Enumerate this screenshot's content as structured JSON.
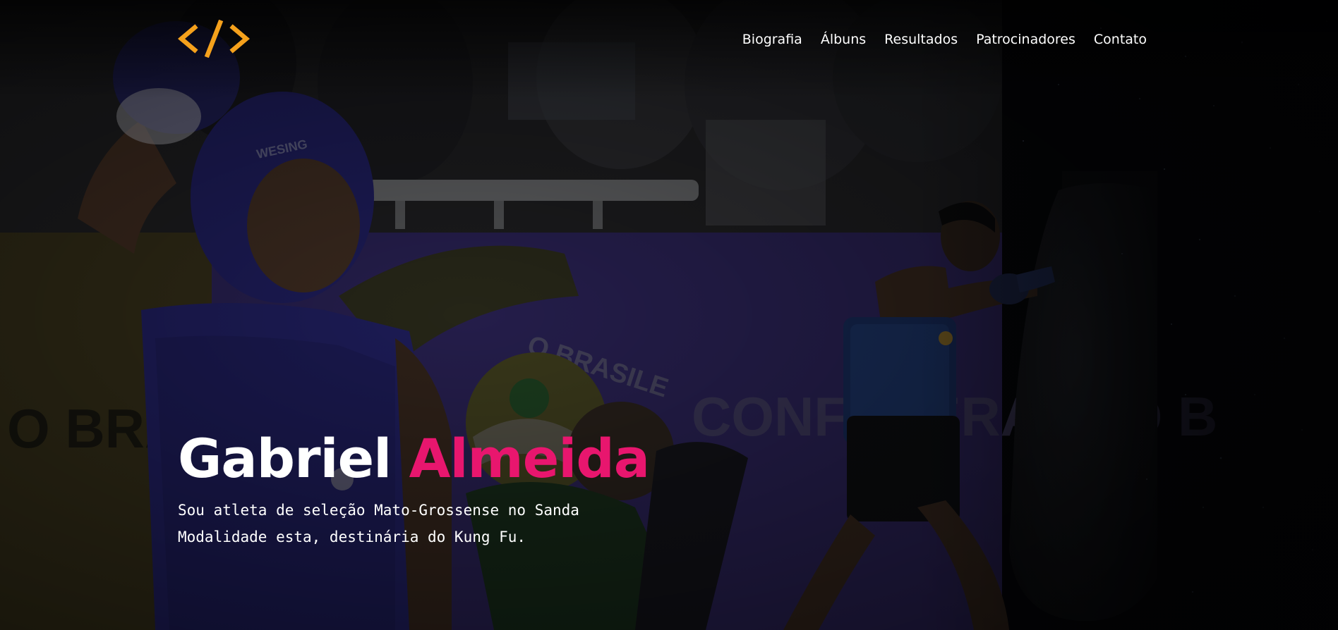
{
  "brand": {
    "logo_symbol": "</>",
    "logo_color": "#f5a11c",
    "logo_icon": "code-brackets-icon"
  },
  "nav": {
    "items": [
      {
        "label": "Biografia"
      },
      {
        "label": "Álbuns"
      },
      {
        "label": "Resultados"
      },
      {
        "label": "Patrocinadores"
      },
      {
        "label": "Contato"
      }
    ]
  },
  "hero": {
    "first_name": "Gabriel",
    "last_name": "Almeida",
    "accent_color": "#e8166e",
    "description_line1": "Sou atleta de seleção Mato-Grossense no Sanda",
    "description_line2": "Modalidade esta, destinária do Kung Fu."
  },
  "background": {
    "banner_partial_text_1": "O BRASILE",
    "banner_partial_text_2": "CONFEDERAÇÃO B",
    "banner_partial_text_3": "O BRA",
    "helmet_brand": "WESING"
  }
}
